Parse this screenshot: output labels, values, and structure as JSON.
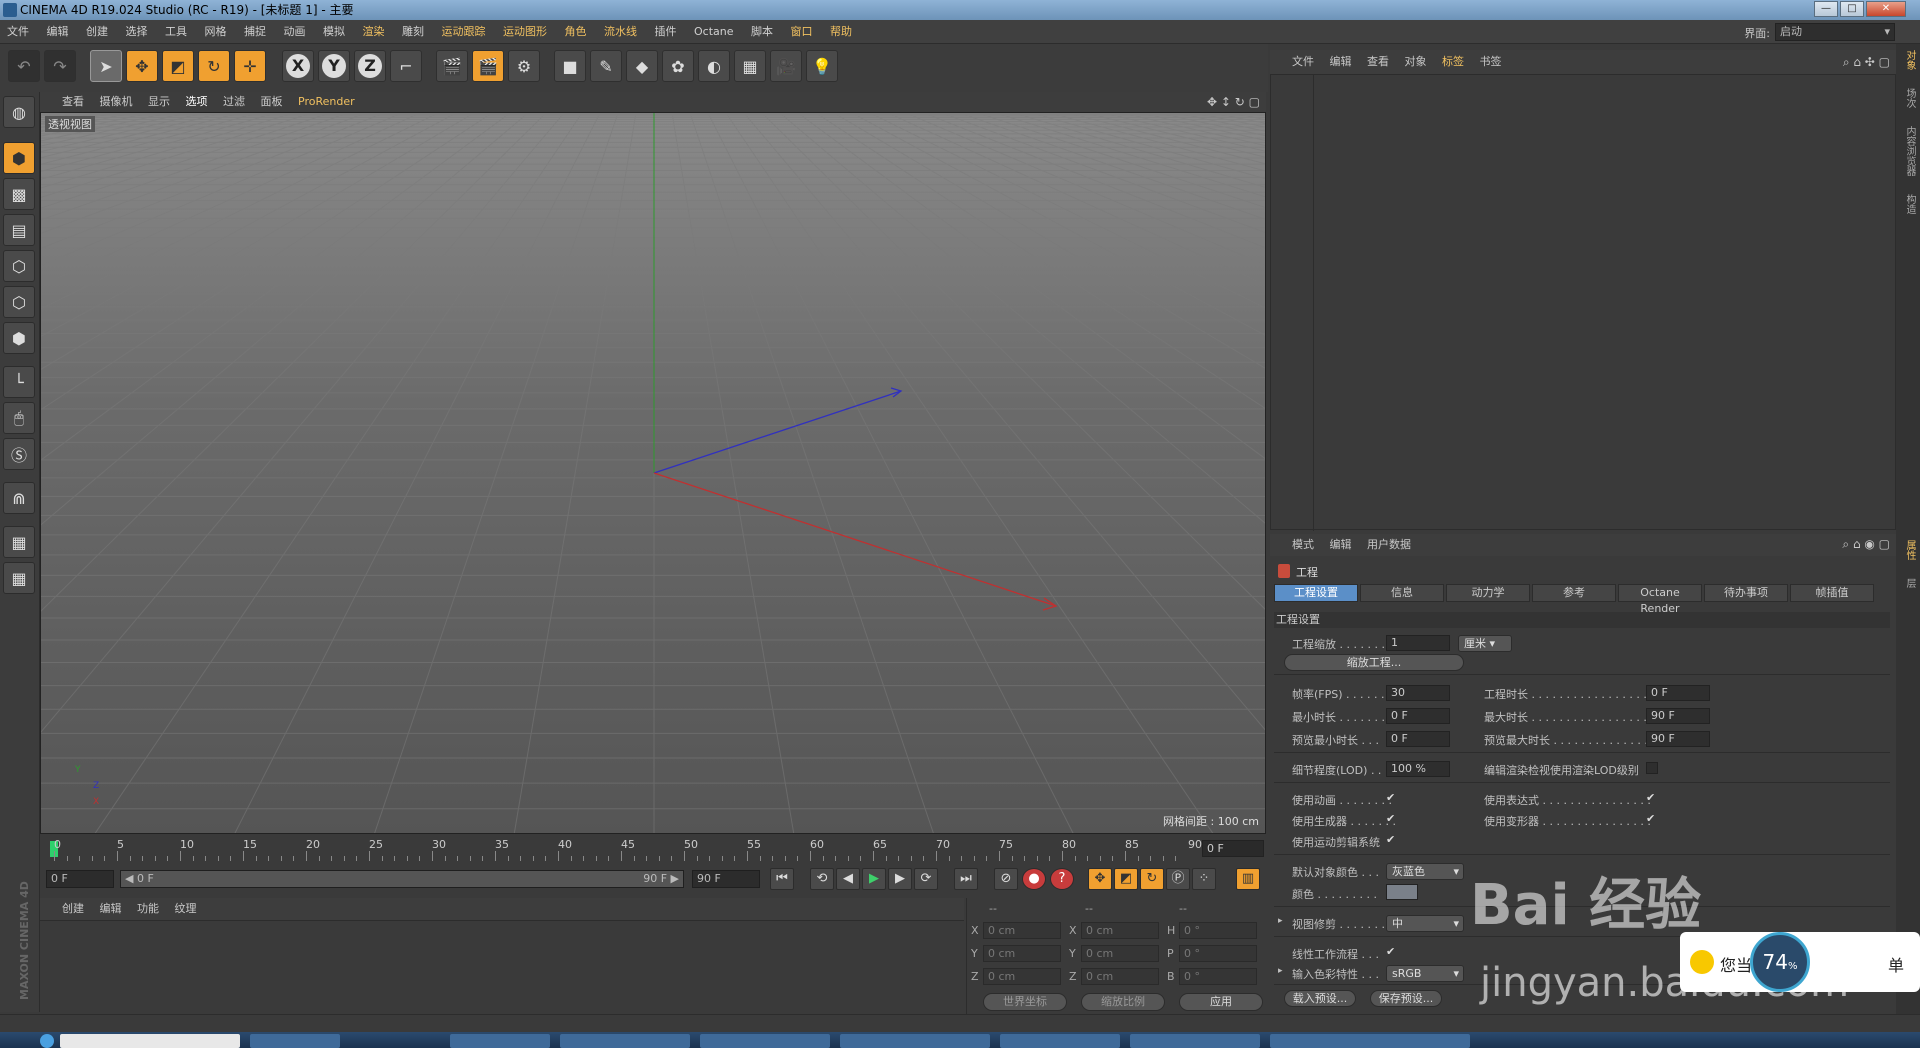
{
  "window": {
    "title": "CINEMA 4D R19.024 Studio (RC - R19) - [未标题 1] - 主要",
    "buttons": {
      "minimize": "—",
      "maximize": "□",
      "close": "✕"
    }
  },
  "menubar": {
    "items": [
      "文件",
      "编辑",
      "创建",
      "选择",
      "工具",
      "网格",
      "捕捉",
      "动画",
      "模拟",
      "渲染",
      "雕刻",
      "运动跟踪",
      "运动图形",
      "角色",
      "流水线",
      "插件",
      "Octane",
      "脚本",
      "窗口",
      "帮助"
    ],
    "interface_label": "界面:",
    "interface_value": "启动"
  },
  "toolbar": {
    "icons": [
      "undo-icon",
      "redo-icon",
      "live-select-icon",
      "move-icon",
      "scale-icon",
      "rotate-icon",
      "transform-icon",
      "x-axis-icon",
      "y-axis-icon",
      "z-axis-icon",
      "coord-system-icon",
      "render-view-icon",
      "render-to-picture-viewer-icon",
      "render-settings-icon",
      "cube-icon",
      "pen-icon",
      "subdivision-icon",
      "cloner-icon",
      "deformer-icon",
      "floor-icon",
      "camera-icon",
      "light-icon"
    ],
    "axis_labels": [
      "X",
      "Y",
      "Z"
    ]
  },
  "viewport": {
    "menu": [
      "查看",
      "摄像机",
      "显示",
      "选项",
      "过滤",
      "面板",
      "ProRender"
    ],
    "label": "透视视图",
    "grid_info": "网格间距 : 100 cm",
    "axis_y": "Y",
    "axis_z": "Z",
    "axis_x": "X"
  },
  "timeline": {
    "ticks": [
      "0",
      "5",
      "10",
      "15",
      "20",
      "25",
      "30",
      "35",
      "40",
      "45",
      "50",
      "55",
      "60",
      "65",
      "70",
      "75",
      "80",
      "85",
      "90"
    ],
    "current_frame": "0 F"
  },
  "transport": {
    "start_field": "0 F",
    "range_start": "◀ 0 F",
    "range_end": "90 F ▶",
    "end_field": "90 F"
  },
  "material": {
    "menu": [
      "创建",
      "编辑",
      "功能",
      "纹理"
    ]
  },
  "coords": {
    "header": [
      "--",
      "--",
      "--"
    ],
    "rows": [
      {
        "a": "X",
        "av": "0 cm",
        "b": "X",
        "bv": "0 cm",
        "c": "H",
        "cv": "0 °"
      },
      {
        "a": "Y",
        "av": "0 cm",
        "b": "Y",
        "bv": "0 cm",
        "c": "P",
        "cv": "0 °"
      },
      {
        "a": "Z",
        "av": "0 cm",
        "b": "Z",
        "bv": "0 cm",
        "c": "B",
        "cv": "0 °"
      }
    ],
    "world_coords": "世界坐标",
    "scale_ratio": "缩放比例",
    "apply": "应用"
  },
  "object_manager": {
    "menu": [
      "文件",
      "编辑",
      "查看",
      "对象",
      "标签",
      "书签"
    ]
  },
  "attributes": {
    "menu": [
      "模式",
      "编辑",
      "用户数据"
    ],
    "title": "工程",
    "tabs": [
      "工程设置",
      "信息",
      "动力学",
      "参考",
      "Octane Render",
      "待办事项",
      "帧插值"
    ],
    "section": "工程设置",
    "project_scale_label": "工程缩放 . . . . . . .",
    "project_scale_value": "1",
    "project_scale_unit": "厘米",
    "scale_project_button": "缩放工程...",
    "fps_label": "帧率(FPS) . . . . . .",
    "fps_value": "30",
    "project_time_label": "工程时长 . . . . . . . . . . . . . . . . .",
    "project_time_value": "0 F",
    "min_time_label": "最小时长 . . . . . . .",
    "min_time_value": "0 F",
    "max_time_label": "最大时长 . . . . . . . . . . . . . . . . .",
    "max_time_value": "90 F",
    "preview_min_label": "预览最小时长 . . .",
    "preview_min_value": "0 F",
    "preview_max_label": "预览最大时长 . . . . . . . . . . . . . .",
    "preview_max_value": "90 F",
    "lod_label": "细节程度(LOD) . . .",
    "lod_value": "100 %",
    "render_lod_label": "编辑渲染检视使用渲染LOD级别",
    "use_animation_label": "使用动画 . . . . . . . .",
    "use_expression_label": "使用表达式 . . . . . . . . . . . . . . . .",
    "use_generators_label": "使用生成器 . . . . . . .",
    "use_deformers_label": "使用变形器 . . . . . . . . . . . . . . . .",
    "use_motion_system_label": "使用运动剪辑系统",
    "default_color_label": "默认对象颜色 . . .",
    "default_color_value": "灰蓝色",
    "color_label": "颜色 . . . . . . . . .",
    "view_clip_label": "视图修剪 . . . . . . .",
    "view_clip_value": "中",
    "linear_workflow_label": "线性工作流程 . . .",
    "input_color_label": "输入色彩特性 . . .",
    "input_color_value": "sRGB",
    "load_preset": "载入预设...",
    "save_preset": "保存预设..."
  },
  "right_vtabs": [
    "对象",
    "场次",
    "内容浏览器",
    "构造",
    "属性",
    "层"
  ],
  "watermark": {
    "text": "Bai 经验",
    "url": "jingyan.baidu.com",
    "popup_text": "您当",
    "popup_suffix": "单",
    "speed": "74",
    "speed_unit": "%"
  }
}
